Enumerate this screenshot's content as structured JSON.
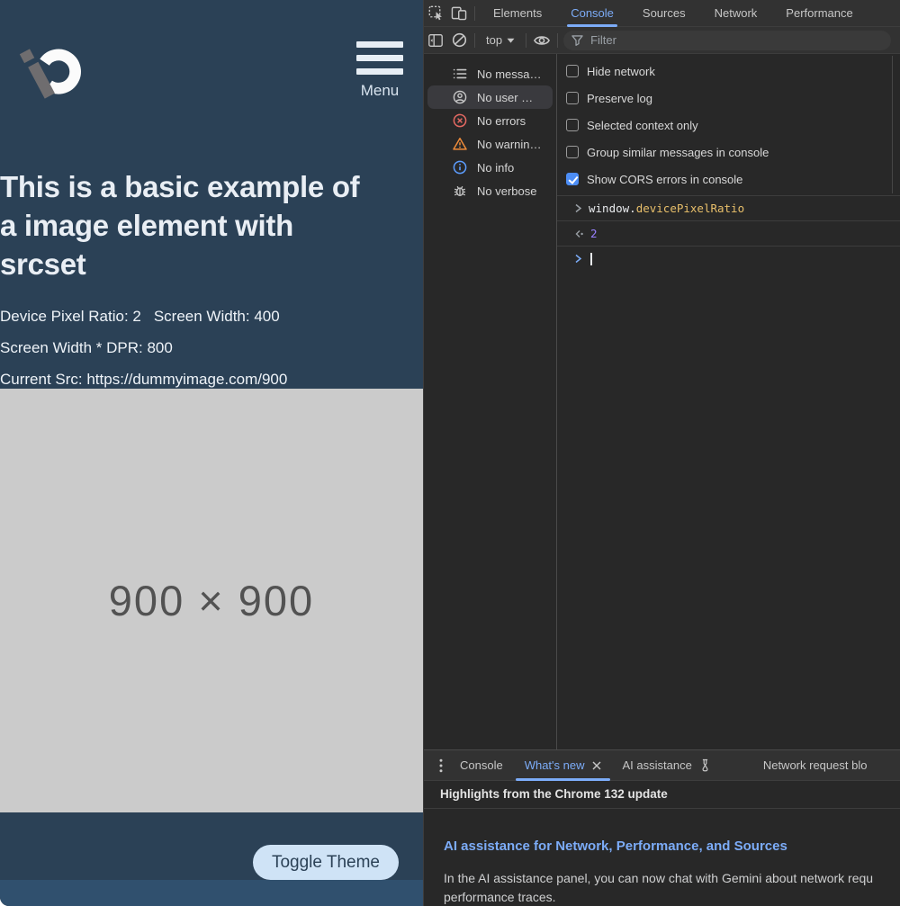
{
  "page": {
    "menu": {
      "label": "Menu"
    },
    "heading_lines": [
      "This is a basic example of",
      "a image element with",
      "srcset"
    ],
    "stats": {
      "dpr": "Device Pixel Ratio: 2",
      "screen_width": "Screen Width: 400",
      "width_dpr": "Screen Width * DPR: 800",
      "current_src": "Current Src: https://dummyimage.com/900"
    },
    "image_placeholder": "900 × 900",
    "toggle_theme_label": "Toggle Theme"
  },
  "devtools": {
    "tabs": [
      {
        "label": "Elements",
        "active": false
      },
      {
        "label": "Console",
        "active": true
      },
      {
        "label": "Sources",
        "active": false
      },
      {
        "label": "Network",
        "active": false
      },
      {
        "label": "Performance",
        "active": false
      }
    ],
    "toolbar": {
      "context": "top",
      "filter_placeholder": "Filter"
    },
    "sidebar_items": [
      {
        "icon": "list-icon",
        "label": "No messa…",
        "selected": false
      },
      {
        "icon": "user-icon",
        "label": "No user …",
        "selected": true
      },
      {
        "icon": "error-icon",
        "label": "No errors",
        "selected": false
      },
      {
        "icon": "warning-icon",
        "label": "No warnin…",
        "selected": false
      },
      {
        "icon": "info-icon",
        "label": "No info",
        "selected": false
      },
      {
        "icon": "verbose-icon",
        "label": "No verbose",
        "selected": false
      }
    ],
    "settings_checkboxes": [
      {
        "label": "Hide network",
        "checked": false
      },
      {
        "label": "Preserve log",
        "checked": false
      },
      {
        "label": "Selected context only",
        "checked": false
      },
      {
        "label": "Group similar messages in console",
        "checked": false
      },
      {
        "label": "Show CORS errors in console",
        "checked": true
      }
    ],
    "console": {
      "expression_object": "window.",
      "expression_property": "devicePixelRatio",
      "result_value": "2"
    },
    "drawer": {
      "tabs": [
        {
          "label": "Console",
          "active": false
        },
        {
          "label": "What's new",
          "active": true,
          "closable": true
        },
        {
          "label": "AI assistance",
          "active": false,
          "experimental": true
        },
        {
          "label": "Network request blo",
          "active": false
        }
      ],
      "subheader": "Highlights from the Chrome 132 update",
      "article_title": "AI assistance for Network, Performance, and Sources",
      "article_body_line1": "In the AI assistance panel, you can now chat with Gemini about network requ",
      "article_body_line2": "performance traces."
    }
  },
  "colors": {
    "accent_blue": "#7cacf8",
    "checkbox_blue": "#4c8df5",
    "error_red": "#e46962",
    "warning_orange": "#ed8b3a",
    "info_blue": "#5c9dff",
    "console_property_yellow": "#e8bf6a",
    "console_number_purple": "#9980ff",
    "page_bg": "#2b4156",
    "page_footer_bg": "#30506e",
    "button_bg": "#cfe3f6",
    "placeholder_bg": "#cbcbcb"
  }
}
